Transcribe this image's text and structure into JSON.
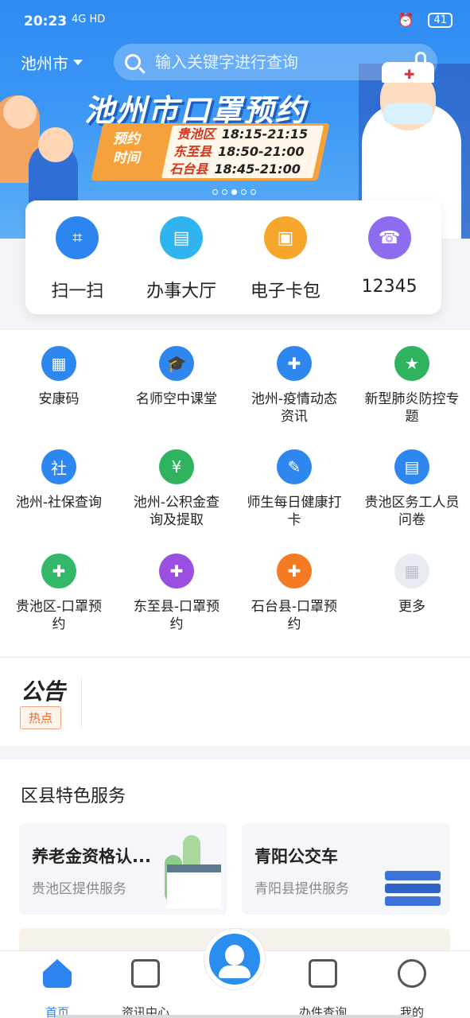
{
  "status_bar": {
    "time": "20:23",
    "signal": "4G HD",
    "battery": "41"
  },
  "header": {
    "city": "池州市",
    "search_placeholder": "输入关键字进行查询"
  },
  "banner": {
    "title": "池州市口罩预约",
    "label": "预约时间",
    "rows": [
      {
        "district": "贵池区",
        "time": "18:15-21:15"
      },
      {
        "district": "东至县",
        "time": "18:50-21:00"
      },
      {
        "district": "石台县",
        "time": "18:45-21:00"
      }
    ],
    "dot_active": 3
  },
  "quick_actions": [
    {
      "label": "扫一扫",
      "icon": "scan-icon",
      "color": "#2d86ef"
    },
    {
      "label": "办事大厅",
      "icon": "clipboard-icon",
      "color": "#2fb4ef"
    },
    {
      "label": "电子卡包",
      "icon": "wallet-icon",
      "color": "#f7a52b"
    },
    {
      "label": "12345",
      "icon": "hotline-icon",
      "color": "#8e6cf0"
    }
  ],
  "services": [
    {
      "label": "安康码",
      "icon": "qr-code-icon",
      "color": "#2e86ef"
    },
    {
      "label": "名师空中课堂",
      "icon": "graduation-cap-icon",
      "color": "#2e86ef"
    },
    {
      "label": "池州-疫情动态资讯",
      "icon": "doctor-icon",
      "color": "#2e86ef"
    },
    {
      "label": "新型肺炎防控专题",
      "icon": "shield-star-icon",
      "color": "#2fb35e"
    },
    {
      "label": "池州-社保查询",
      "icon": "social-security-icon",
      "color": "#2e86ef"
    },
    {
      "label": "池州-公积金查询及提取",
      "icon": "fund-search-icon",
      "color": "#2fb35e"
    },
    {
      "label": "师生每日健康打卡",
      "icon": "edit-form-icon",
      "color": "#2e86ef"
    },
    {
      "label": "贵池区务工人员问卷",
      "icon": "document-icon",
      "color": "#2e86ef"
    },
    {
      "label": "贵池区-口罩预约",
      "icon": "mask-green-icon",
      "color": "#32b868"
    },
    {
      "label": "东至县-口罩预约",
      "icon": "mask-purple-icon",
      "color": "#9a4fe0"
    },
    {
      "label": "石台县-口罩预约",
      "icon": "mask-orange-icon",
      "color": "#f57a24"
    },
    {
      "label": "更多",
      "icon": "grid-more-icon",
      "color": "#b9c1cd"
    }
  ],
  "notice": {
    "logo": "公告",
    "badge": "热点"
  },
  "district": {
    "title": "区县特色服务",
    "cards": [
      {
        "title": "养老金资格认...",
        "subtitle": "贵池区提供服务"
      },
      {
        "title": "青阳公交车",
        "subtitle": "青阳县提供服务"
      }
    ]
  },
  "tabs": [
    {
      "label": "首页",
      "icon": "home-icon",
      "active": true
    },
    {
      "label": "资讯中心",
      "icon": "message-icon",
      "active": false
    },
    {
      "label": "办件查询",
      "icon": "document-search-icon",
      "active": false
    },
    {
      "label": "我的",
      "icon": "user-icon",
      "active": false
    }
  ]
}
